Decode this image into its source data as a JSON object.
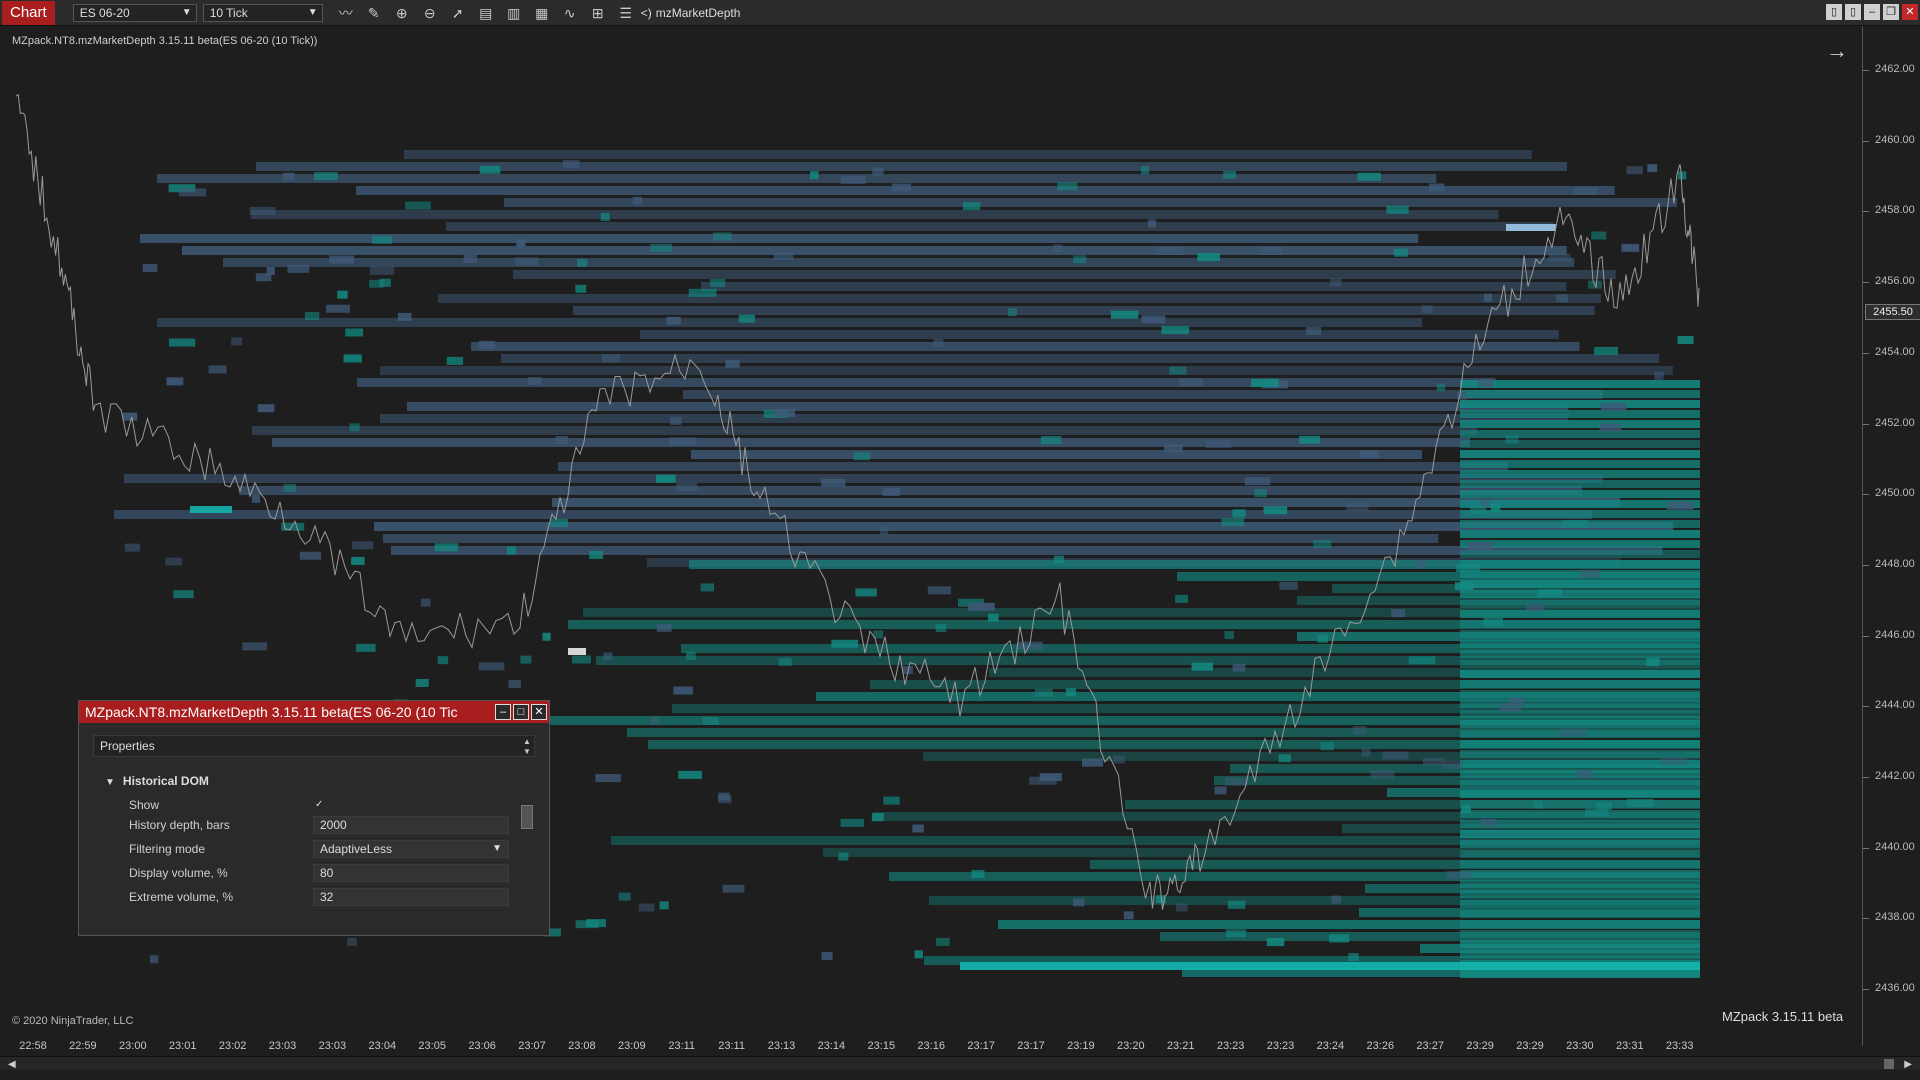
{
  "toolbar": {
    "tab": "Chart",
    "instrument": "ES 06-20",
    "interval": "10 Tick",
    "indicator_name": "mzMarketDepth",
    "icons": [
      "draw-line-icon",
      "pencil-icon",
      "zoom-in-icon",
      "zoom-out-icon",
      "pointer-icon",
      "data-box-icon",
      "bar-style-icon",
      "chart-trader-icon",
      "strategies-icon",
      "properties-icon",
      "list-icon",
      "arrow-left-icon"
    ]
  },
  "chart": {
    "indicator_label": "MZpack.NT8.mzMarketDepth 3.15.11 beta(ES 06-20 (10 Tick))",
    "copyright": "© 2020 NinjaTrader, LLC",
    "brand": "MZpack 3.15.11 beta",
    "current_price": "2455.50",
    "price_labels": [
      "2462.00",
      "2460.00",
      "2458.00",
      "2456.00",
      "2454.00",
      "2452.00",
      "2450.00",
      "2448.00",
      "2446.00",
      "2444.00",
      "2442.00",
      "2440.00",
      "2438.00",
      "2436.00"
    ],
    "time_labels": [
      "22:58",
      "22:59",
      "23:00",
      "23:01",
      "23:02",
      "23:03",
      "23:03",
      "23:04",
      "23:05",
      "23:06",
      "23:07",
      "23:08",
      "23:09",
      "23:11",
      "23:11",
      "23:13",
      "23:14",
      "23:15",
      "23:16",
      "23:17",
      "23:17",
      "23:19",
      "23:20",
      "23:21",
      "23:23",
      "23:23",
      "23:24",
      "23:26",
      "23:27",
      "23:29",
      "23:29",
      "23:30",
      "23:31",
      "23:33"
    ]
  },
  "dialog": {
    "title": "MZpack.NT8.mzMarketDepth 3.15.11 beta(ES 06-20 (10 Tic",
    "header": "Properties",
    "section": "Historical DOM",
    "props": [
      {
        "label": "Show",
        "value": "✓"
      },
      {
        "label": "History depth, bars",
        "value": "2000"
      },
      {
        "label": "Filtering mode",
        "value": "AdaptiveLess"
      },
      {
        "label": "Display volume, %",
        "value": "80"
      },
      {
        "label": "Extreme volume, %",
        "value": "32"
      }
    ]
  },
  "colors": {
    "ask": "#3f5a78",
    "bid": "#138a82",
    "accent": "#a81d1d"
  }
}
